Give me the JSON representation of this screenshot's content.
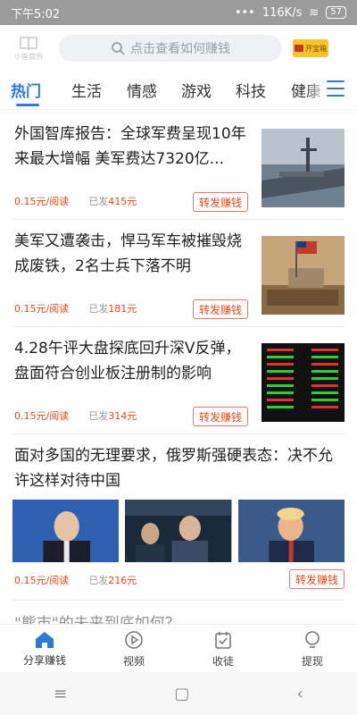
{
  "status_bar": {
    "time": "下午5:02",
    "network": "116K/s",
    "battery": "57"
  },
  "header": {
    "logo_text": "小鱼简历",
    "search_placeholder": "点击查看如何赚钱",
    "promo_label": "开宝箱"
  },
  "tabs": [
    {
      "label": "热门",
      "active": true
    },
    {
      "label": "生活"
    },
    {
      "label": "情感"
    },
    {
      "label": "游戏"
    },
    {
      "label": "科技"
    },
    {
      "label": "健康"
    }
  ],
  "articles": [
    {
      "title": "外国智库报告：全球军费呈现10年来最大增幅 美军费达7320亿...",
      "price": "0.15元/阅读",
      "sent_label": "已发",
      "sent_count": "415元",
      "share_label": "转发赚钱"
    },
    {
      "title": "美军又遭袭击，悍马军车被摧毁烧成废铁，2名士兵下落不明",
      "price": "0.15元/阅读",
      "sent_label": "已发",
      "sent_count": "181元",
      "share_label": "转发赚钱"
    },
    {
      "title": "4.28午评大盘探底回升深V反弹，盘面符合创业板注册制的影响",
      "price": "0.15元/阅读",
      "sent_label": "已发",
      "sent_count": "314元",
      "share_label": "转发赚钱"
    },
    {
      "title": "面对多国的无理要求，俄罗斯强硬表态：决不允许这样对待中国",
      "price": "0.15元/阅读",
      "sent_label": "已发",
      "sent_count": "216元",
      "share_label": "转发赚钱"
    }
  ],
  "partial_article_title": "\"熊市\"的未来到底如何？",
  "bottom_nav": [
    {
      "label": "分享赚钱",
      "icon": "home-icon",
      "active": true
    },
    {
      "label": "视频",
      "icon": "play-icon"
    },
    {
      "label": "收徒",
      "icon": "checklist-icon"
    },
    {
      "label": "提现",
      "icon": "bulb-icon"
    }
  ],
  "colors": {
    "accent_blue": "#2d79d8",
    "price_red": "#e64a19",
    "promo_yellow": "#f7c22c"
  }
}
